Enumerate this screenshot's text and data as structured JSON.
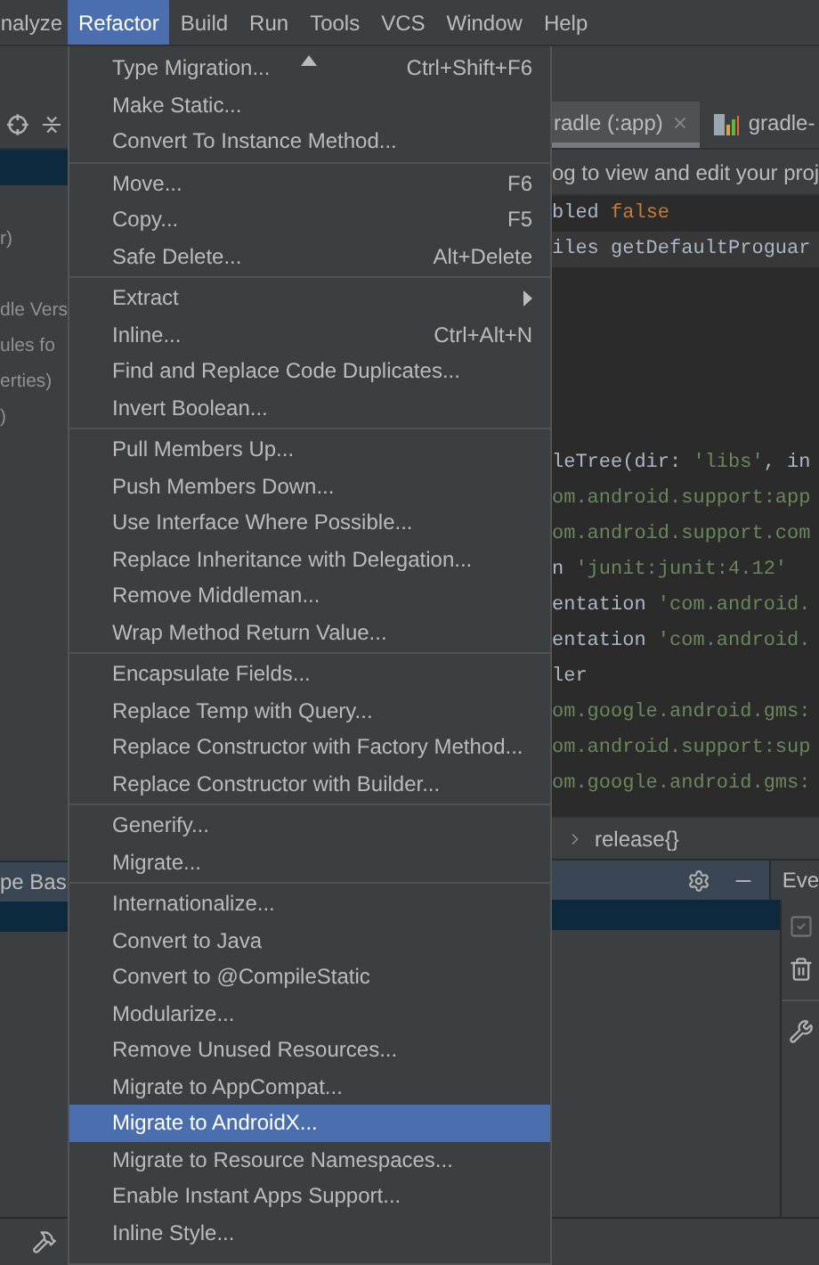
{
  "menu_bar": [
    {
      "label": "nalyze",
      "selected": false
    },
    {
      "label": "Refactor",
      "selected": true
    },
    {
      "label": "Build",
      "selected": false
    },
    {
      "label": "Run",
      "selected": false
    },
    {
      "label": "Tools",
      "selected": false
    },
    {
      "label": "VCS",
      "selected": false
    },
    {
      "label": "Window",
      "selected": false
    },
    {
      "label": "Help",
      "selected": false
    }
  ],
  "project_panel": {
    "rows": [
      {
        "kind": "blank"
      },
      {
        "kind": "text",
        "label": "r)"
      },
      {
        "kind": "blank"
      },
      {
        "kind": "text",
        "label": "dle Vers"
      },
      {
        "kind": "text",
        "label": "ules fo"
      },
      {
        "kind": "text",
        "label": "erties)"
      },
      {
        "kind": "text",
        "label": ")"
      }
    ],
    "bottom_title": "pe Bas"
  },
  "editor": {
    "tabs": [
      {
        "label": "radle (:app)",
        "selected": true
      },
      {
        "label": "gradle-",
        "selected": false
      }
    ],
    "notice": "og to view and edit your proj",
    "lines": [
      {
        "kind": "code",
        "current": false,
        "tokens": [
          {
            "text": "bled ",
            "kind": "plain"
          },
          {
            "text": "false",
            "kind": "keyword"
          }
        ]
      },
      {
        "kind": "code",
        "current": true,
        "tokens": [
          {
            "text": "iles getDefaultProguar",
            "kind": "plain"
          }
        ]
      },
      {
        "kind": "blank"
      },
      {
        "kind": "blank"
      },
      {
        "kind": "blank"
      },
      {
        "kind": "blank"
      },
      {
        "kind": "blank"
      },
      {
        "kind": "code",
        "current": false,
        "tokens": [
          {
            "text": "leTree(dir: ",
            "kind": "plain"
          },
          {
            "text": "'libs'",
            "kind": "string"
          },
          {
            "text": ", in",
            "kind": "plain"
          }
        ]
      },
      {
        "kind": "code",
        "current": false,
        "tokens": [
          {
            "text": "om.android.support:app",
            "kind": "string"
          }
        ]
      },
      {
        "kind": "code",
        "current": false,
        "tokens": [
          {
            "text": "om.android.support.com",
            "kind": "string"
          }
        ]
      },
      {
        "kind": "code",
        "current": false,
        "tokens": [
          {
            "text": "n ",
            "kind": "plain"
          },
          {
            "text": "'junit:junit:4.12'",
            "kind": "string"
          }
        ]
      },
      {
        "kind": "code",
        "current": false,
        "tokens": [
          {
            "text": "entation ",
            "kind": "plain"
          },
          {
            "text": "'com.android.",
            "kind": "string"
          }
        ]
      },
      {
        "kind": "code",
        "current": false,
        "tokens": [
          {
            "text": "entation ",
            "kind": "plain"
          },
          {
            "text": "'com.android.",
            "kind": "string"
          }
        ]
      },
      {
        "kind": "code",
        "current": false,
        "tokens": [
          {
            "text": "ler",
            "kind": "plain"
          }
        ]
      },
      {
        "kind": "code",
        "current": false,
        "tokens": [
          {
            "text": "om.google.android.gms:",
            "kind": "string"
          }
        ]
      },
      {
        "kind": "code",
        "current": false,
        "tokens": [
          {
            "text": "om.android.support:sup",
            "kind": "string"
          }
        ]
      },
      {
        "kind": "code",
        "current": false,
        "tokens": [
          {
            "text": "om.google.android.gms:",
            "kind": "string"
          }
        ]
      }
    ],
    "breadcrumb": "release{}"
  },
  "event_panel": {
    "title": "Eve"
  },
  "refactor_menu": {
    "scroll_up": true,
    "items": [
      {
        "kind": "item",
        "label": "Type Migration...",
        "shortcut": "Ctrl+Shift+F6",
        "submenu": false,
        "selected": false
      },
      {
        "kind": "item",
        "label": "Make Static...",
        "submenu": false,
        "selected": false
      },
      {
        "kind": "item",
        "label": "Convert To Instance Method...",
        "submenu": false,
        "selected": false
      },
      {
        "kind": "separator"
      },
      {
        "kind": "item",
        "label": "Move...",
        "shortcut": "F6",
        "submenu": false,
        "selected": false
      },
      {
        "kind": "item",
        "label": "Copy...",
        "shortcut": "F5",
        "submenu": false,
        "selected": false
      },
      {
        "kind": "item",
        "label": "Safe Delete...",
        "shortcut": "Alt+Delete",
        "submenu": false,
        "selected": false
      },
      {
        "kind": "separator"
      },
      {
        "kind": "item",
        "label": "Extract",
        "submenu": true,
        "selected": false
      },
      {
        "kind": "item",
        "label": "Inline...",
        "shortcut": "Ctrl+Alt+N",
        "submenu": false,
        "selected": false
      },
      {
        "kind": "item",
        "label": "Find and Replace Code Duplicates...",
        "submenu": false,
        "selected": false
      },
      {
        "kind": "item",
        "label": "Invert Boolean...",
        "submenu": false,
        "selected": false
      },
      {
        "kind": "separator"
      },
      {
        "kind": "item",
        "label": "Pull Members Up...",
        "submenu": false,
        "selected": false
      },
      {
        "kind": "item",
        "label": "Push Members Down...",
        "submenu": false,
        "selected": false
      },
      {
        "kind": "item",
        "label": "Use Interface Where Possible...",
        "submenu": false,
        "selected": false
      },
      {
        "kind": "item",
        "label": "Replace Inheritance with Delegation...",
        "submenu": false,
        "selected": false
      },
      {
        "kind": "item",
        "label": "Remove Middleman...",
        "submenu": false,
        "selected": false
      },
      {
        "kind": "item",
        "label": "Wrap Method Return Value...",
        "submenu": false,
        "selected": false
      },
      {
        "kind": "separator"
      },
      {
        "kind": "item",
        "label": "Encapsulate Fields...",
        "submenu": false,
        "selected": false
      },
      {
        "kind": "item",
        "label": "Replace Temp with Query...",
        "submenu": false,
        "selected": false
      },
      {
        "kind": "item",
        "label": "Replace Constructor with Factory Method...",
        "submenu": false,
        "selected": false
      },
      {
        "kind": "item",
        "label": "Replace Constructor with Builder...",
        "submenu": false,
        "selected": false
      },
      {
        "kind": "separator"
      },
      {
        "kind": "item",
        "label": "Generify...",
        "submenu": false,
        "selected": false
      },
      {
        "kind": "item",
        "label": "Migrate...",
        "submenu": false,
        "selected": false
      },
      {
        "kind": "separator"
      },
      {
        "kind": "item",
        "label": "Internationalize...",
        "submenu": false,
        "selected": false
      },
      {
        "kind": "item",
        "label": "Convert to Java",
        "submenu": false,
        "selected": false
      },
      {
        "kind": "item",
        "label": "Convert to @CompileStatic",
        "submenu": false,
        "selected": false
      },
      {
        "kind": "item",
        "label": "Modularize...",
        "submenu": false,
        "selected": false
      },
      {
        "kind": "item",
        "label": "Remove Unused Resources...",
        "submenu": false,
        "selected": false
      },
      {
        "kind": "item",
        "label": "Migrate to AppCompat...",
        "submenu": false,
        "selected": false
      },
      {
        "kind": "item",
        "label": "Migrate to AndroidX...",
        "submenu": false,
        "selected": true
      },
      {
        "kind": "item",
        "label": "Migrate to Resource Namespaces...",
        "submenu": false,
        "selected": false
      },
      {
        "kind": "item",
        "label": "Enable Instant Apps Support...",
        "submenu": false,
        "selected": false
      },
      {
        "kind": "item",
        "label": "Inline Style...",
        "submenu": false,
        "selected": false
      }
    ]
  }
}
